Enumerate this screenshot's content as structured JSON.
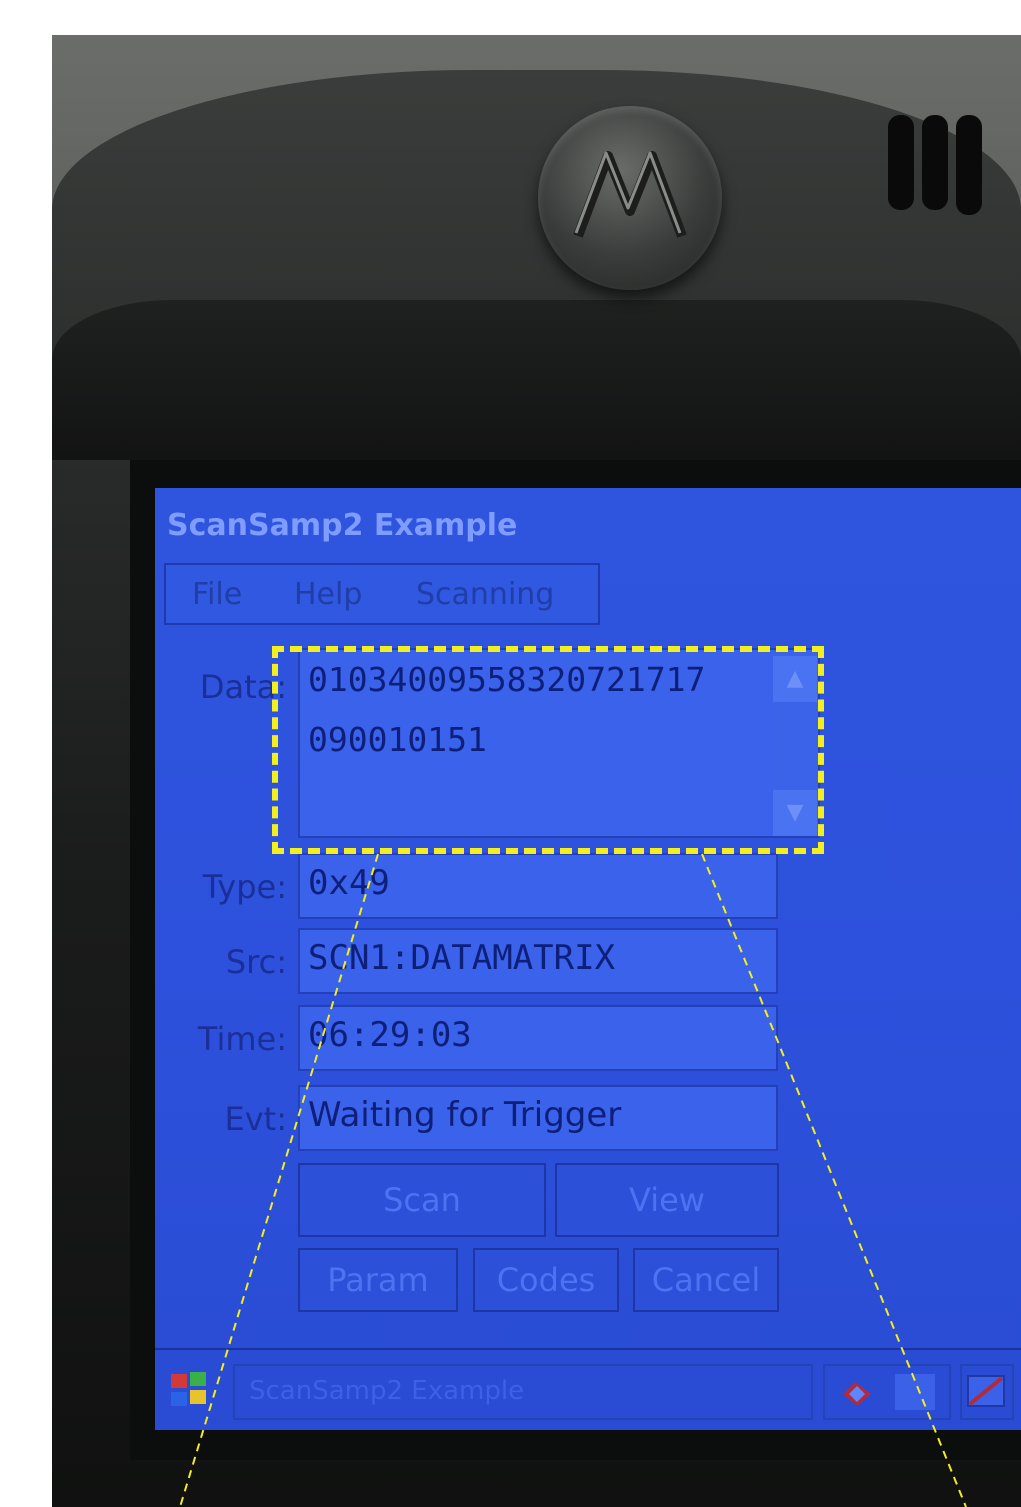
{
  "device": {
    "brand_logo_icon": "motorola-logo"
  },
  "window": {
    "title": "ScanSamp2 Example"
  },
  "menu": {
    "items": [
      "File",
      "Help",
      "Scanning"
    ]
  },
  "form": {
    "data_label": "Data:",
    "data_value": "0103400955832072171​7\n090010151",
    "type_label": "Type:",
    "type_value": "0x49",
    "src_label": "Src:",
    "src_value": "SCN1:DATAMATRIX",
    "time_label": "Time:",
    "time_value": "06:29:03",
    "evt_label": "Evt:",
    "evt_value": "Waiting for Trigger"
  },
  "buttons": {
    "scan": "Scan",
    "view": "View",
    "param": "Param",
    "codes": "Codes",
    "cancel": "Cancel"
  },
  "taskbar": {
    "start_icon": "windows-flag-icon",
    "task_label": "ScanSamp2 Example"
  },
  "annotation": {
    "highlight_color": "#f3ee1e"
  }
}
